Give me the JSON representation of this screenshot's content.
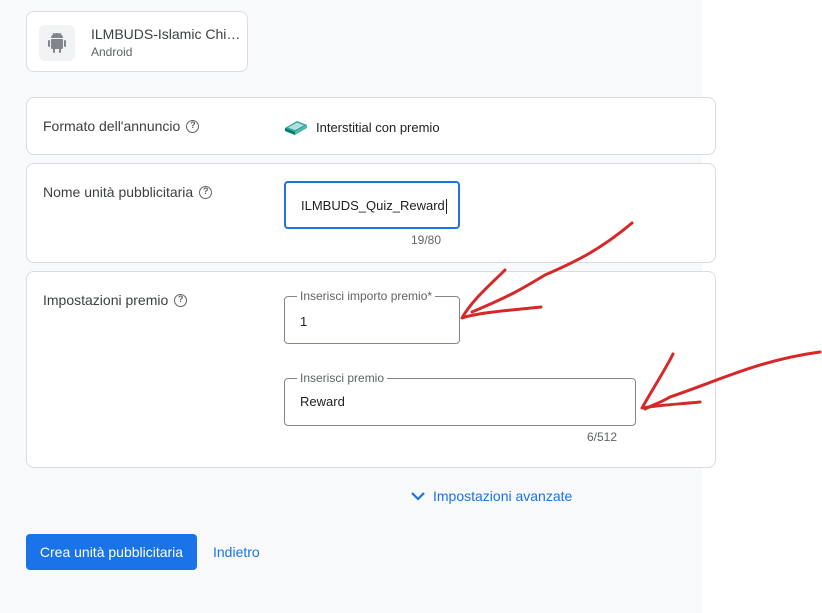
{
  "app": {
    "name": "ILMBUDS-Islamic Chi…",
    "platform": "Android"
  },
  "format_section": {
    "label": "Formato dell'annuncio",
    "value": "Interstitial con premio"
  },
  "name_section": {
    "label": "Nome unità pubblicitaria",
    "value": "ILMBUDS_Quiz_Reward",
    "counter": "19/80"
  },
  "reward_section": {
    "label": "Impostazioni premio",
    "amount_label": "Inserisci importo premio*",
    "amount_value": "1",
    "item_label": "Inserisci premio",
    "item_value": "Reward",
    "item_counter": "6/512"
  },
  "advanced_label": "Impostazioni avanzate",
  "actions": {
    "create_label": "Crea unità pubblicitaria",
    "back_label": "Indietro"
  },
  "colors": {
    "primary": "#1a73e8",
    "annotation": "#d62828"
  }
}
